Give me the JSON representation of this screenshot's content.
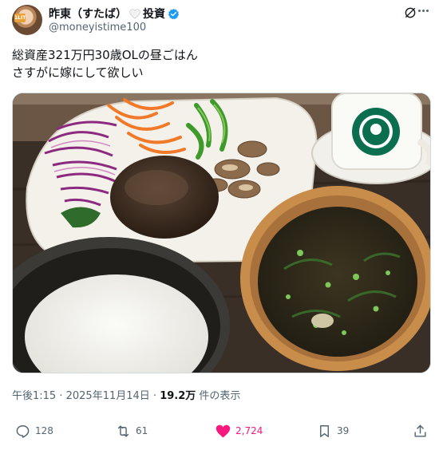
{
  "author": {
    "display_name": "昨東（すたば）",
    "label": "投資",
    "handle": "@moneyistime100",
    "avatar_badge": "1LIT"
  },
  "tweet": {
    "line1": "総資産321万円30歳OLの昼ごはん",
    "line2": "さすがに嫁にして欲しい"
  },
  "meta": {
    "time": "午後1:15",
    "separator": " · ",
    "date": "2025年11月14日",
    "views_count": "19.2万",
    "views_label": "件の表示"
  },
  "actions": {
    "replies": "128",
    "reposts": "61",
    "likes": "2,724",
    "bookmarks": "39"
  },
  "icons": {
    "verified": "verified-badge",
    "heart_label": "heart",
    "like_color": "#f91880",
    "verified_color": "#1d9bf0"
  }
}
